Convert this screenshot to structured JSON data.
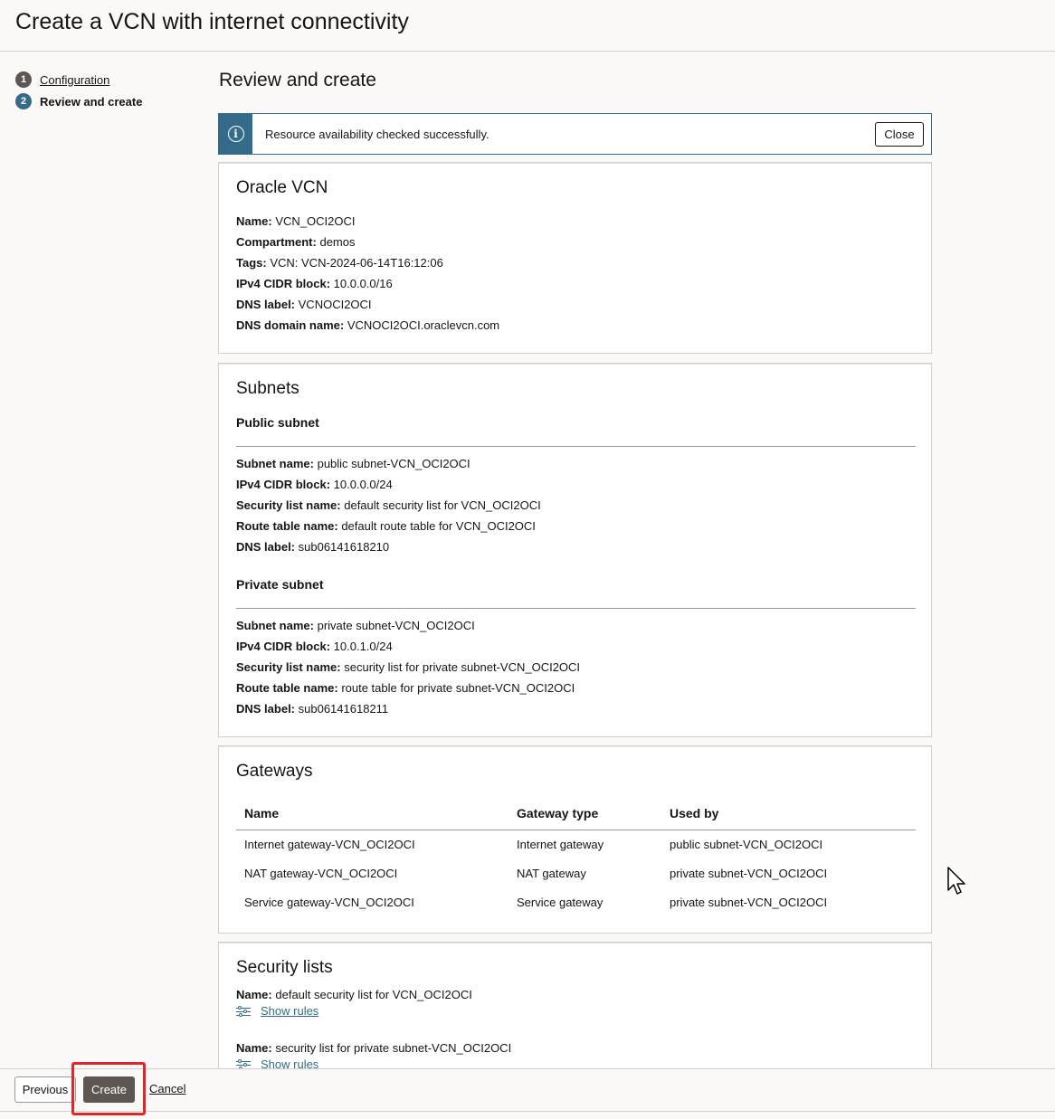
{
  "header": {
    "title": "Create a VCN with internet connectivity"
  },
  "steps": [
    {
      "num": "1",
      "label": "Configuration"
    },
    {
      "num": "2",
      "label": "Review and create"
    }
  ],
  "main": {
    "title": "Review and create",
    "banner": {
      "icon": "info-icon",
      "message": "Resource availability checked successfully.",
      "close_label": "Close"
    }
  },
  "vcn": {
    "title": "Oracle VCN",
    "fields": [
      {
        "label": "Name:",
        "value": "VCN_OCI2OCI"
      },
      {
        "label": "Compartment:",
        "value": "demos"
      },
      {
        "label": "Tags:",
        "value": "VCN: VCN-2024-06-14T16:12:06"
      },
      {
        "label": "IPv4 CIDR block:",
        "value": "10.0.0.0/16"
      },
      {
        "label": "DNS label:",
        "value": "VCNOCI2OCI"
      },
      {
        "label": "DNS domain name:",
        "value": "VCNOCI2OCI.oraclevcn.com"
      }
    ]
  },
  "subnets": {
    "title": "Subnets",
    "public": {
      "heading": "Public subnet",
      "fields": [
        {
          "label": "Subnet name:",
          "value": "public subnet-VCN_OCI2OCI"
        },
        {
          "label": "IPv4 CIDR block:",
          "value": "10.0.0.0/24"
        },
        {
          "label": "Security list name:",
          "value": "default security list for VCN_OCI2OCI"
        },
        {
          "label": "Route table name:",
          "value": "default route table for VCN_OCI2OCI"
        },
        {
          "label": "DNS label:",
          "value": "sub06141618210"
        }
      ]
    },
    "private": {
      "heading": "Private subnet",
      "fields": [
        {
          "label": "Subnet name:",
          "value": "private subnet-VCN_OCI2OCI"
        },
        {
          "label": "IPv4 CIDR block:",
          "value": "10.0.1.0/24"
        },
        {
          "label": "Security list name:",
          "value": "security list for private subnet-VCN_OCI2OCI"
        },
        {
          "label": "Route table name:",
          "value": "route table for private subnet-VCN_OCI2OCI"
        },
        {
          "label": "DNS label:",
          "value": "sub06141618211"
        }
      ]
    }
  },
  "gateways": {
    "title": "Gateways",
    "columns": [
      "Name",
      "Gateway type",
      "Used by"
    ],
    "rows": [
      [
        "Internet gateway-VCN_OCI2OCI",
        "Internet gateway",
        "public subnet-VCN_OCI2OCI"
      ],
      [
        "NAT gateway-VCN_OCI2OCI",
        "NAT gateway",
        "private subnet-VCN_OCI2OCI"
      ],
      [
        "Service gateway-VCN_OCI2OCI",
        "Service gateway",
        "private subnet-VCN_OCI2OCI"
      ]
    ]
  },
  "security_lists": {
    "title": "Security lists",
    "items": [
      {
        "label": "Name:",
        "value": "default security list for VCN_OCI2OCI",
        "link": "Show rules"
      },
      {
        "label": "Name:",
        "value": "security list for private subnet-VCN_OCI2OCI",
        "link": "Show rules"
      }
    ]
  },
  "footer": {
    "previous_label": "Previous",
    "create_label": "Create",
    "cancel_label": "Cancel"
  },
  "colors": {
    "accent": "#356b8a",
    "primary_button": "#5c5752",
    "highlight": "#e0262b"
  }
}
